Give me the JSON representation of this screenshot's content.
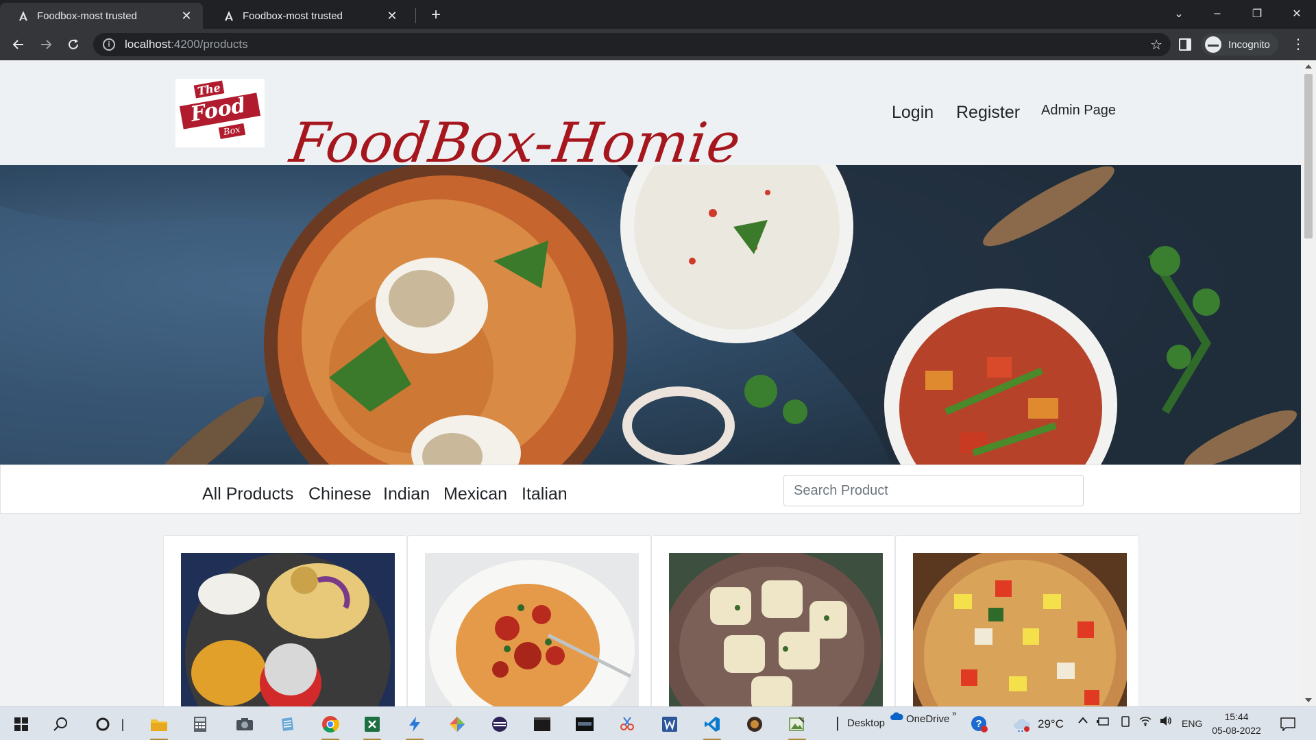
{
  "browser": {
    "tabs": [
      {
        "title": "Foodbox-most trusted",
        "active": true
      },
      {
        "title": "Foodbox-most trusted",
        "active": false
      }
    ],
    "new_tab": "+",
    "url_host": "localhost",
    "url_path": ":4200/products",
    "profile_label": "Incognito"
  },
  "site": {
    "logo": {
      "the": "The",
      "food": "Food",
      "box": "Box"
    },
    "brand": "FoodBox-Homie",
    "nav": {
      "login": "Login",
      "register": "Register",
      "admin": "Admin Page"
    },
    "categories": [
      "All Products",
      "Chinese",
      "Indian",
      "Mexican",
      "Italian"
    ],
    "search_placeholder": "Search Product",
    "cards": [
      {
        "image": "indian-thali-image"
      },
      {
        "image": "spaghetti-image"
      },
      {
        "image": "ravioli-image"
      },
      {
        "image": "pizza-image"
      }
    ]
  },
  "taskbar": {
    "desktop_label": "Desktop",
    "onedrive_label": "OneDrive",
    "weather": "29°C",
    "language": "ENG",
    "time": "15:44",
    "date": "05-08-2022"
  },
  "colors": {
    "brand_red": "#a5161d",
    "chrome_dark": "#202124",
    "chrome_toolbar": "#35363a"
  }
}
